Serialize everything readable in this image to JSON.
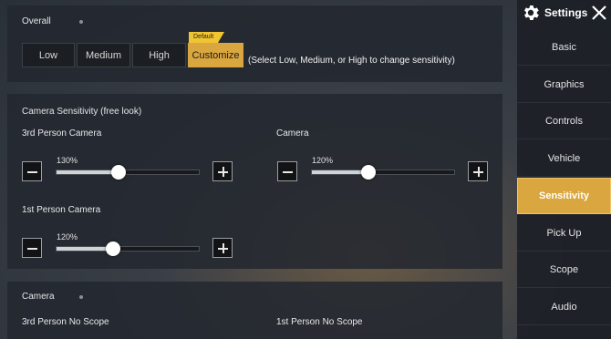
{
  "overall": {
    "title": "Overall",
    "options": [
      "Low",
      "Medium",
      "High",
      "Customize"
    ],
    "selected": "Customize",
    "default_badge": "Default",
    "hint": "(Select Low, Medium, or High to change sensitivity)"
  },
  "camera_free": {
    "title": "Camera Sensitivity (free look)",
    "third_person": {
      "label": "3rd Person Camera",
      "value_text": "130%",
      "value": 130
    },
    "camera": {
      "label": "Camera",
      "value_text": "120%",
      "value": 120
    },
    "first_person": {
      "label": "1st Person Camera",
      "value_text": "120%",
      "value": 120
    },
    "slider_min": 0,
    "slider_max": 300
  },
  "camera_section": {
    "title": "Camera",
    "third_no_scope": "3rd Person No Scope",
    "first_no_scope": "1st Person No Scope"
  },
  "sidebar": {
    "title": "Settings",
    "items": [
      "Basic",
      "Graphics",
      "Controls",
      "Vehicle",
      "Sensitivity",
      "Pick Up",
      "Scope",
      "Audio"
    ],
    "active": "Sensitivity"
  },
  "colors": {
    "accent": "#d9a63f",
    "badge": "#f1c431"
  },
  "icons": {
    "settings": "gear-icon",
    "close": "close-icon",
    "minus": "minus-icon",
    "plus": "plus-icon"
  }
}
